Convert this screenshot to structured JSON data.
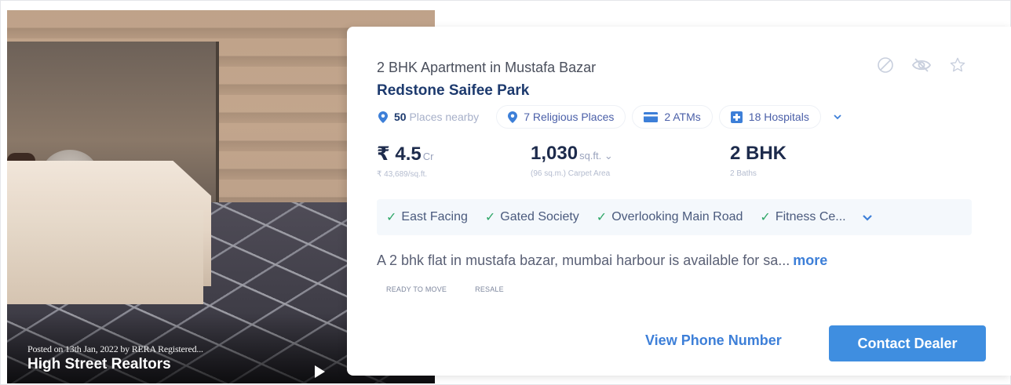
{
  "listing": {
    "posted_text": "Posted on 13th Jan, 2022 by RERA Registered...",
    "dealer_name": "High Street Realtors",
    "subtitle": "2 BHK Apartment in Mustafa Bazar",
    "title": "Redstone Saifee Park"
  },
  "actions": {
    "icons": [
      "block-icon",
      "hide-icon",
      "star-icon"
    ]
  },
  "nearby": {
    "places_count": "50",
    "places_label": "Places nearby",
    "religious": "7 Religious Places",
    "atms": "2 ATMs",
    "hospitals": "18 Hospitals"
  },
  "stats": {
    "price": "₹ 4.5",
    "price_unit": "Cr",
    "price_per_sqft": "₹ 43,689/sq.ft.",
    "area": "1,030",
    "area_unit": "sq.ft. ⌄",
    "area_sub": "(96 sq.m.) Carpet Area",
    "config": "2 BHK",
    "baths": "2 Baths"
  },
  "amenities": [
    "East Facing",
    "Gated Society",
    "Overlooking Main Road",
    "Fitness Ce..."
  ],
  "description": {
    "text": "A 2 bhk flat in mustafa bazar, mumbai harbour is available for sa...",
    "more_label": "more"
  },
  "tags": [
    "READY TO MOVE",
    "RESALE"
  ],
  "buttons": {
    "view_phone": "View Phone Number",
    "contact": "Contact Dealer"
  },
  "colors": {
    "accent": "#3f8ee0",
    "title": "#1d3a6e",
    "check": "#2fa768"
  }
}
